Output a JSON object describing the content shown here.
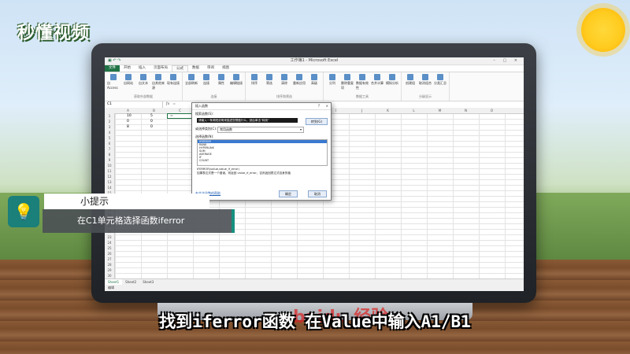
{
  "logo": {
    "text": "秒懂视频"
  },
  "excel": {
    "title": "工作簿1 - Microsoft Excel",
    "tabs": [
      "文件",
      "开始",
      "插入",
      "页面布局",
      "公式",
      "数据",
      "审阅",
      "视图"
    ],
    "active_tab": "公式",
    "ribbon": {
      "groups": [
        {
          "name": "获取外部数据",
          "buttons": [
            "自Access",
            "自网站",
            "自文本",
            "自其他来源",
            "现有连接"
          ]
        },
        {
          "name": "连接",
          "buttons": [
            "全部刷新",
            "连接",
            "属性",
            "编辑链接"
          ]
        },
        {
          "name": "排序和筛选",
          "buttons": [
            "排序",
            "筛选",
            "清除",
            "重新应用",
            "高级"
          ]
        },
        {
          "name": "数据工具",
          "buttons": [
            "分列",
            "删除重复项",
            "数据有效性",
            "合并计算",
            "模拟分析"
          ]
        },
        {
          "name": "分级显示",
          "buttons": [
            "创建组",
            "取消组合",
            "分类汇总"
          ]
        }
      ]
    },
    "namebox": "C1",
    "formula": "=",
    "columns": [
      "A",
      "B",
      "C",
      "D",
      "E",
      "F",
      "G",
      "H",
      "I",
      "J",
      "K",
      "L",
      "M",
      "N",
      "O"
    ],
    "rows": [
      "1",
      "2",
      "3",
      "4",
      "5",
      "6",
      "7",
      "8",
      "9",
      "10",
      "11",
      "12",
      "13",
      "14",
      "15",
      "16",
      "17",
      "18",
      "19",
      "20",
      "21",
      "22",
      "23",
      "24",
      "25",
      "26",
      "27",
      "28",
      "29",
      "30"
    ],
    "cells": [
      {
        "r": 0,
        "a": "10",
        "b": "5",
        "c": "="
      },
      {
        "r": 1,
        "a": "0",
        "b": "0",
        "c": ""
      },
      {
        "r": 2,
        "a": "8",
        "b": "0",
        "c": ""
      }
    ],
    "sheets": [
      "Sheet1",
      "Sheet2",
      "Sheet3"
    ],
    "status": "编辑"
  },
  "dialog": {
    "title": "插入函数",
    "close": "×",
    "help": "?",
    "search_label": "搜索函数(S):",
    "search_value": "请输入一条简短说明来描述您想做什么，然后单击“转到”",
    "go_label": "转到(G)",
    "category_label": "或选择类别(C):",
    "category_value": "常用函数",
    "function_label": "选择函数(N):",
    "functions": [
      "IFERROR",
      "RANK",
      "HYPERLINK",
      "SUM",
      "AVERAGE",
      "IF",
      "COUNT"
    ],
    "selected": "IFERROR",
    "syntax": "IFERROR(value,value_if_error)",
    "description": "如果表达式是一个错误，则返回 value_if_error，否则返回表达式自身的值",
    "help_link": "有关该函数的帮助",
    "ok_label": "确定",
    "cancel_label": "取消"
  },
  "tip": {
    "header": "小提示",
    "body": "在C1单元格选择函数iferror"
  },
  "subtitle": "找到iferror函数 在Value中输入A1/B1",
  "watermark": "baidu 经验"
}
